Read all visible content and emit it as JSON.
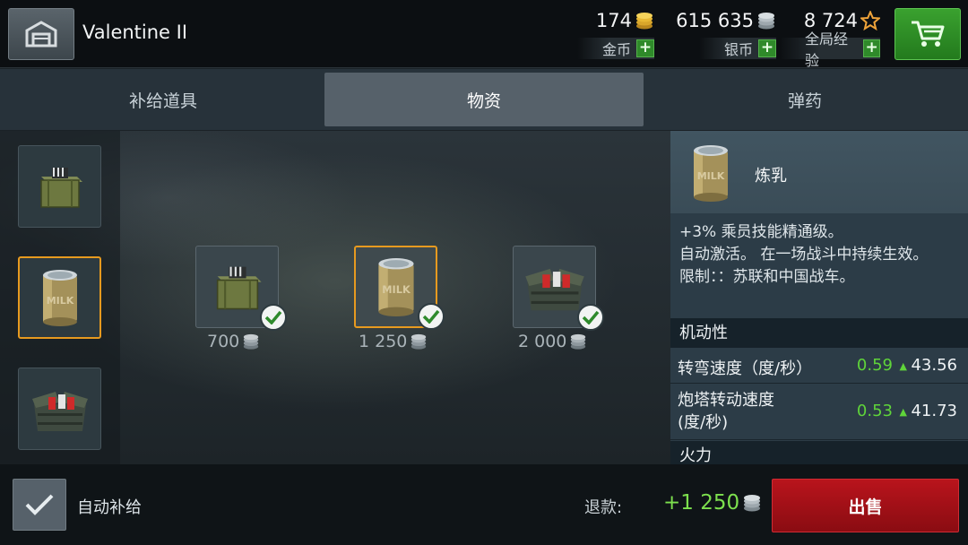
{
  "header": {
    "vehicle_name": "Valentine II",
    "gold": {
      "value": "174",
      "label": "金币",
      "icon": "gold-coins-icon"
    },
    "silver": {
      "value": "615 635",
      "label": "银币",
      "icon": "silver-coins-icon"
    },
    "xp": {
      "value": "8 724",
      "label": "全局经验",
      "icon": "star-icon"
    },
    "plus_symbol": "+"
  },
  "tabs": [
    {
      "label": "补给道具",
      "active": false
    },
    {
      "label": "物资",
      "active": true
    },
    {
      "label": "弹药",
      "active": false
    }
  ],
  "sidebar": {
    "items": [
      {
        "icon": "ammo-crate-icon",
        "selected": false
      },
      {
        "icon": "milk-can-icon",
        "selected": true
      },
      {
        "icon": "supply-box-icon",
        "selected": false
      }
    ]
  },
  "grid": {
    "items": [
      {
        "icon": "ammo-crate-icon",
        "price": "700",
        "selected": false,
        "equipped": true
      },
      {
        "icon": "milk-can-icon",
        "price": "1 250",
        "selected": true,
        "equipped": true
      },
      {
        "icon": "supply-box-icon",
        "price": "2 000",
        "selected": false,
        "equipped": true
      }
    ]
  },
  "details": {
    "name": "炼乳",
    "desc_1": "+3% 乘员技能精通级。",
    "desc_2": "自动激活。 在一场战斗中持续生效。",
    "desc_3": "限制：：苏联和中国战车。",
    "section_mobility": "机动性",
    "stats": [
      {
        "name": "转弯速度（度/秒）",
        "delta": "0.59",
        "base": "43.56"
      },
      {
        "name": "炮塔转动速度\n(度/秒)",
        "delta": "0.53",
        "base": "41.73"
      }
    ],
    "section_firepower": "火力",
    "arrow": "▲"
  },
  "footer": {
    "auto_resupply_label": "自动补给",
    "refund_label": "退款:",
    "refund_value": "+1 250",
    "sell_label": "出售"
  },
  "colors": {
    "accent_selected": "#e79a1f",
    "positive": "#5fd43a",
    "sell": "#b9141c",
    "cart": "#3aa12f"
  }
}
